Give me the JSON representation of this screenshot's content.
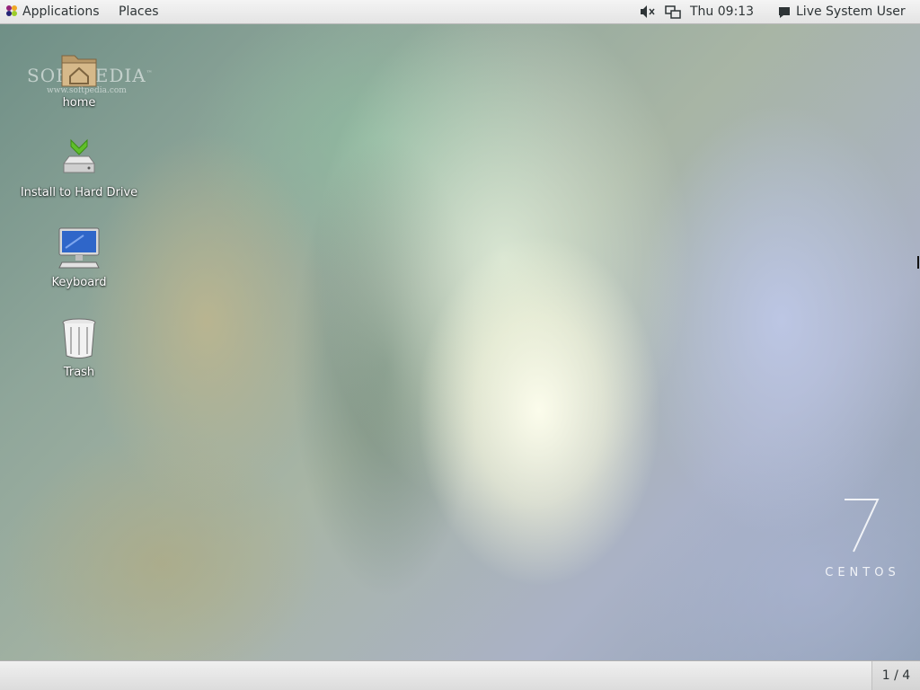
{
  "top_bar": {
    "applications_label": "Applications",
    "places_label": "Places",
    "volume_icon": "speaker-muted-icon",
    "network_icon": "network-wired-icon",
    "clock": "Thu 09:13",
    "user_label": "Live System User",
    "user_icon": "chat-bubble-icon"
  },
  "desktop": {
    "icons": [
      {
        "label": "home",
        "icon": "folder-home-icon"
      },
      {
        "label": "Install to Hard Drive",
        "icon": "install-drive-icon"
      },
      {
        "label": "Keyboard",
        "icon": "computer-monitor-icon"
      },
      {
        "label": "Trash",
        "icon": "trash-icon"
      }
    ],
    "watermark": {
      "main": "SOFTPEDIA",
      "trademark": "™",
      "sub": "www.softpedia.com"
    },
    "brand": {
      "numeral": "7",
      "name": "CENTOS"
    }
  },
  "bottom_bar": {
    "workspace": "1 / 4"
  }
}
